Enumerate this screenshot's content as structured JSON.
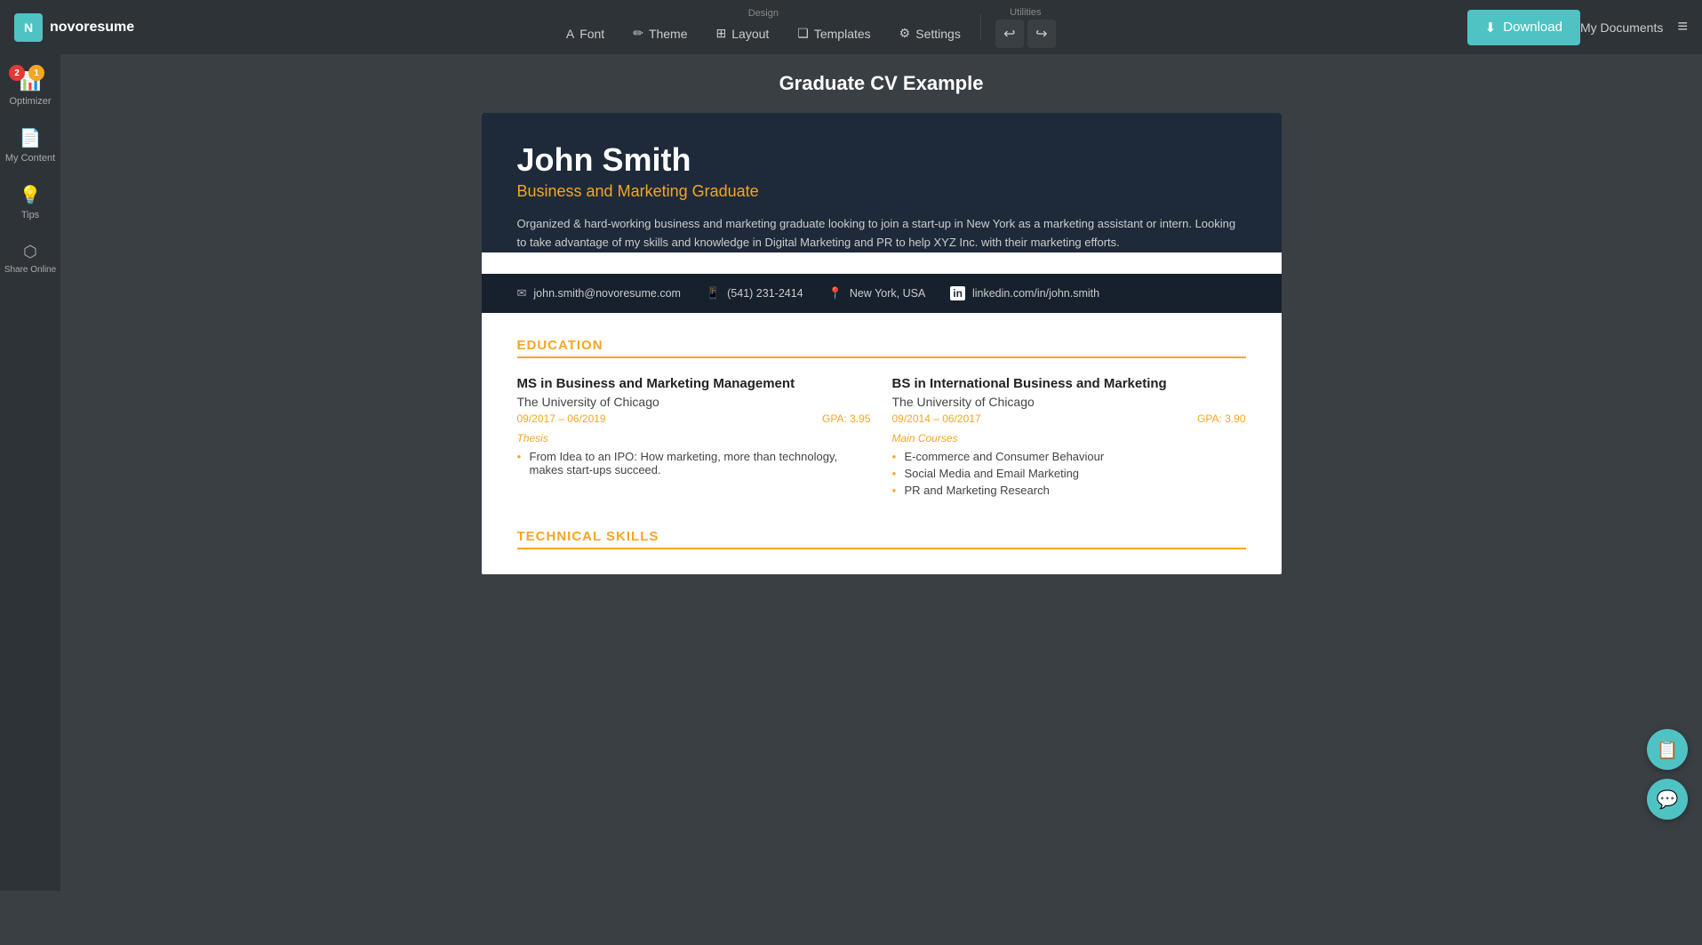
{
  "app": {
    "logo_text": "novoresume",
    "logo_short": "N"
  },
  "navbar": {
    "design_label": "Design",
    "utilities_label": "Utilities",
    "items": [
      {
        "id": "font",
        "label": "Font",
        "icon": "A"
      },
      {
        "id": "theme",
        "label": "Theme",
        "icon": "✏"
      },
      {
        "id": "layout",
        "label": "Layout",
        "icon": "⊞"
      },
      {
        "id": "templates",
        "label": "Templates",
        "icon": "❏"
      },
      {
        "id": "settings",
        "label": "Settings",
        "icon": "⚙"
      }
    ],
    "download_label": "Download",
    "my_documents_label": "My Documents"
  },
  "sidebar": {
    "items": [
      {
        "id": "optimizer",
        "label": "Optimizer",
        "icon": "📊",
        "badge1": "2",
        "badge2": "1"
      },
      {
        "id": "my-content",
        "label": "My Content",
        "icon": "📄"
      },
      {
        "id": "tips",
        "label": "Tips",
        "icon": "💡"
      },
      {
        "id": "share-online",
        "label": "Share Online",
        "icon": "⬡"
      }
    ]
  },
  "page": {
    "title": "Graduate CV Example"
  },
  "cv": {
    "name": "John Smith",
    "title": "Business and Marketing Graduate",
    "summary": "Organized & hard-working business and marketing graduate looking to join a start-up in New York as a marketing assistant or intern. Looking to take advantage of my skills and knowledge in Digital Marketing and PR to help XYZ Inc. with their marketing efforts.",
    "contact": {
      "email": "john.smith@novoresume.com",
      "phone": "(541) 231-2414",
      "location": "New York, USA",
      "linkedin": "linkedin.com/in/john.smith"
    },
    "education": {
      "section_title": "EDUCATION",
      "entries": [
        {
          "degree": "MS in Business and Marketing Management",
          "school": "The University of Chicago",
          "date_range": "09/2017 – 06/2019",
          "gpa": "GPA: 3.95",
          "sublabel": "Thesis",
          "bullets": [
            "From Idea to an IPO: How marketing, more than technology, makes start-ups succeed."
          ]
        },
        {
          "degree": "BS in International Business and Marketing",
          "school": "The University of Chicago",
          "date_range": "09/2014 – 06/2017",
          "gpa": "GPA: 3.90",
          "sublabel": "Main Courses",
          "bullets": [
            "E-commerce and Consumer Behaviour",
            "Social Media and Email Marketing",
            "PR and Marketing Research"
          ]
        }
      ]
    },
    "technical_skills": {
      "section_title": "TECHNICAL SKILLS"
    }
  }
}
